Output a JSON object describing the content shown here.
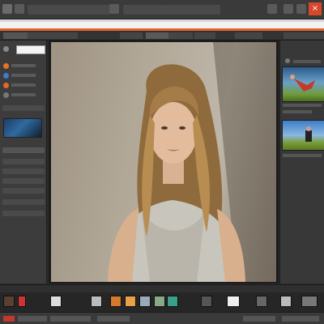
{
  "colors": {
    "accent": "#e0672c",
    "close": "#d9472b",
    "panel": "#3c3c3c",
    "canvas": "#1c1c1c"
  },
  "window": {
    "close_glyph": "×"
  },
  "menu": {
    "icons": [
      "app-icon",
      "file-icon",
      "edit-icon",
      "view-icon",
      "filter-icon",
      "window-icon",
      "help-icon"
    ]
  }
}
